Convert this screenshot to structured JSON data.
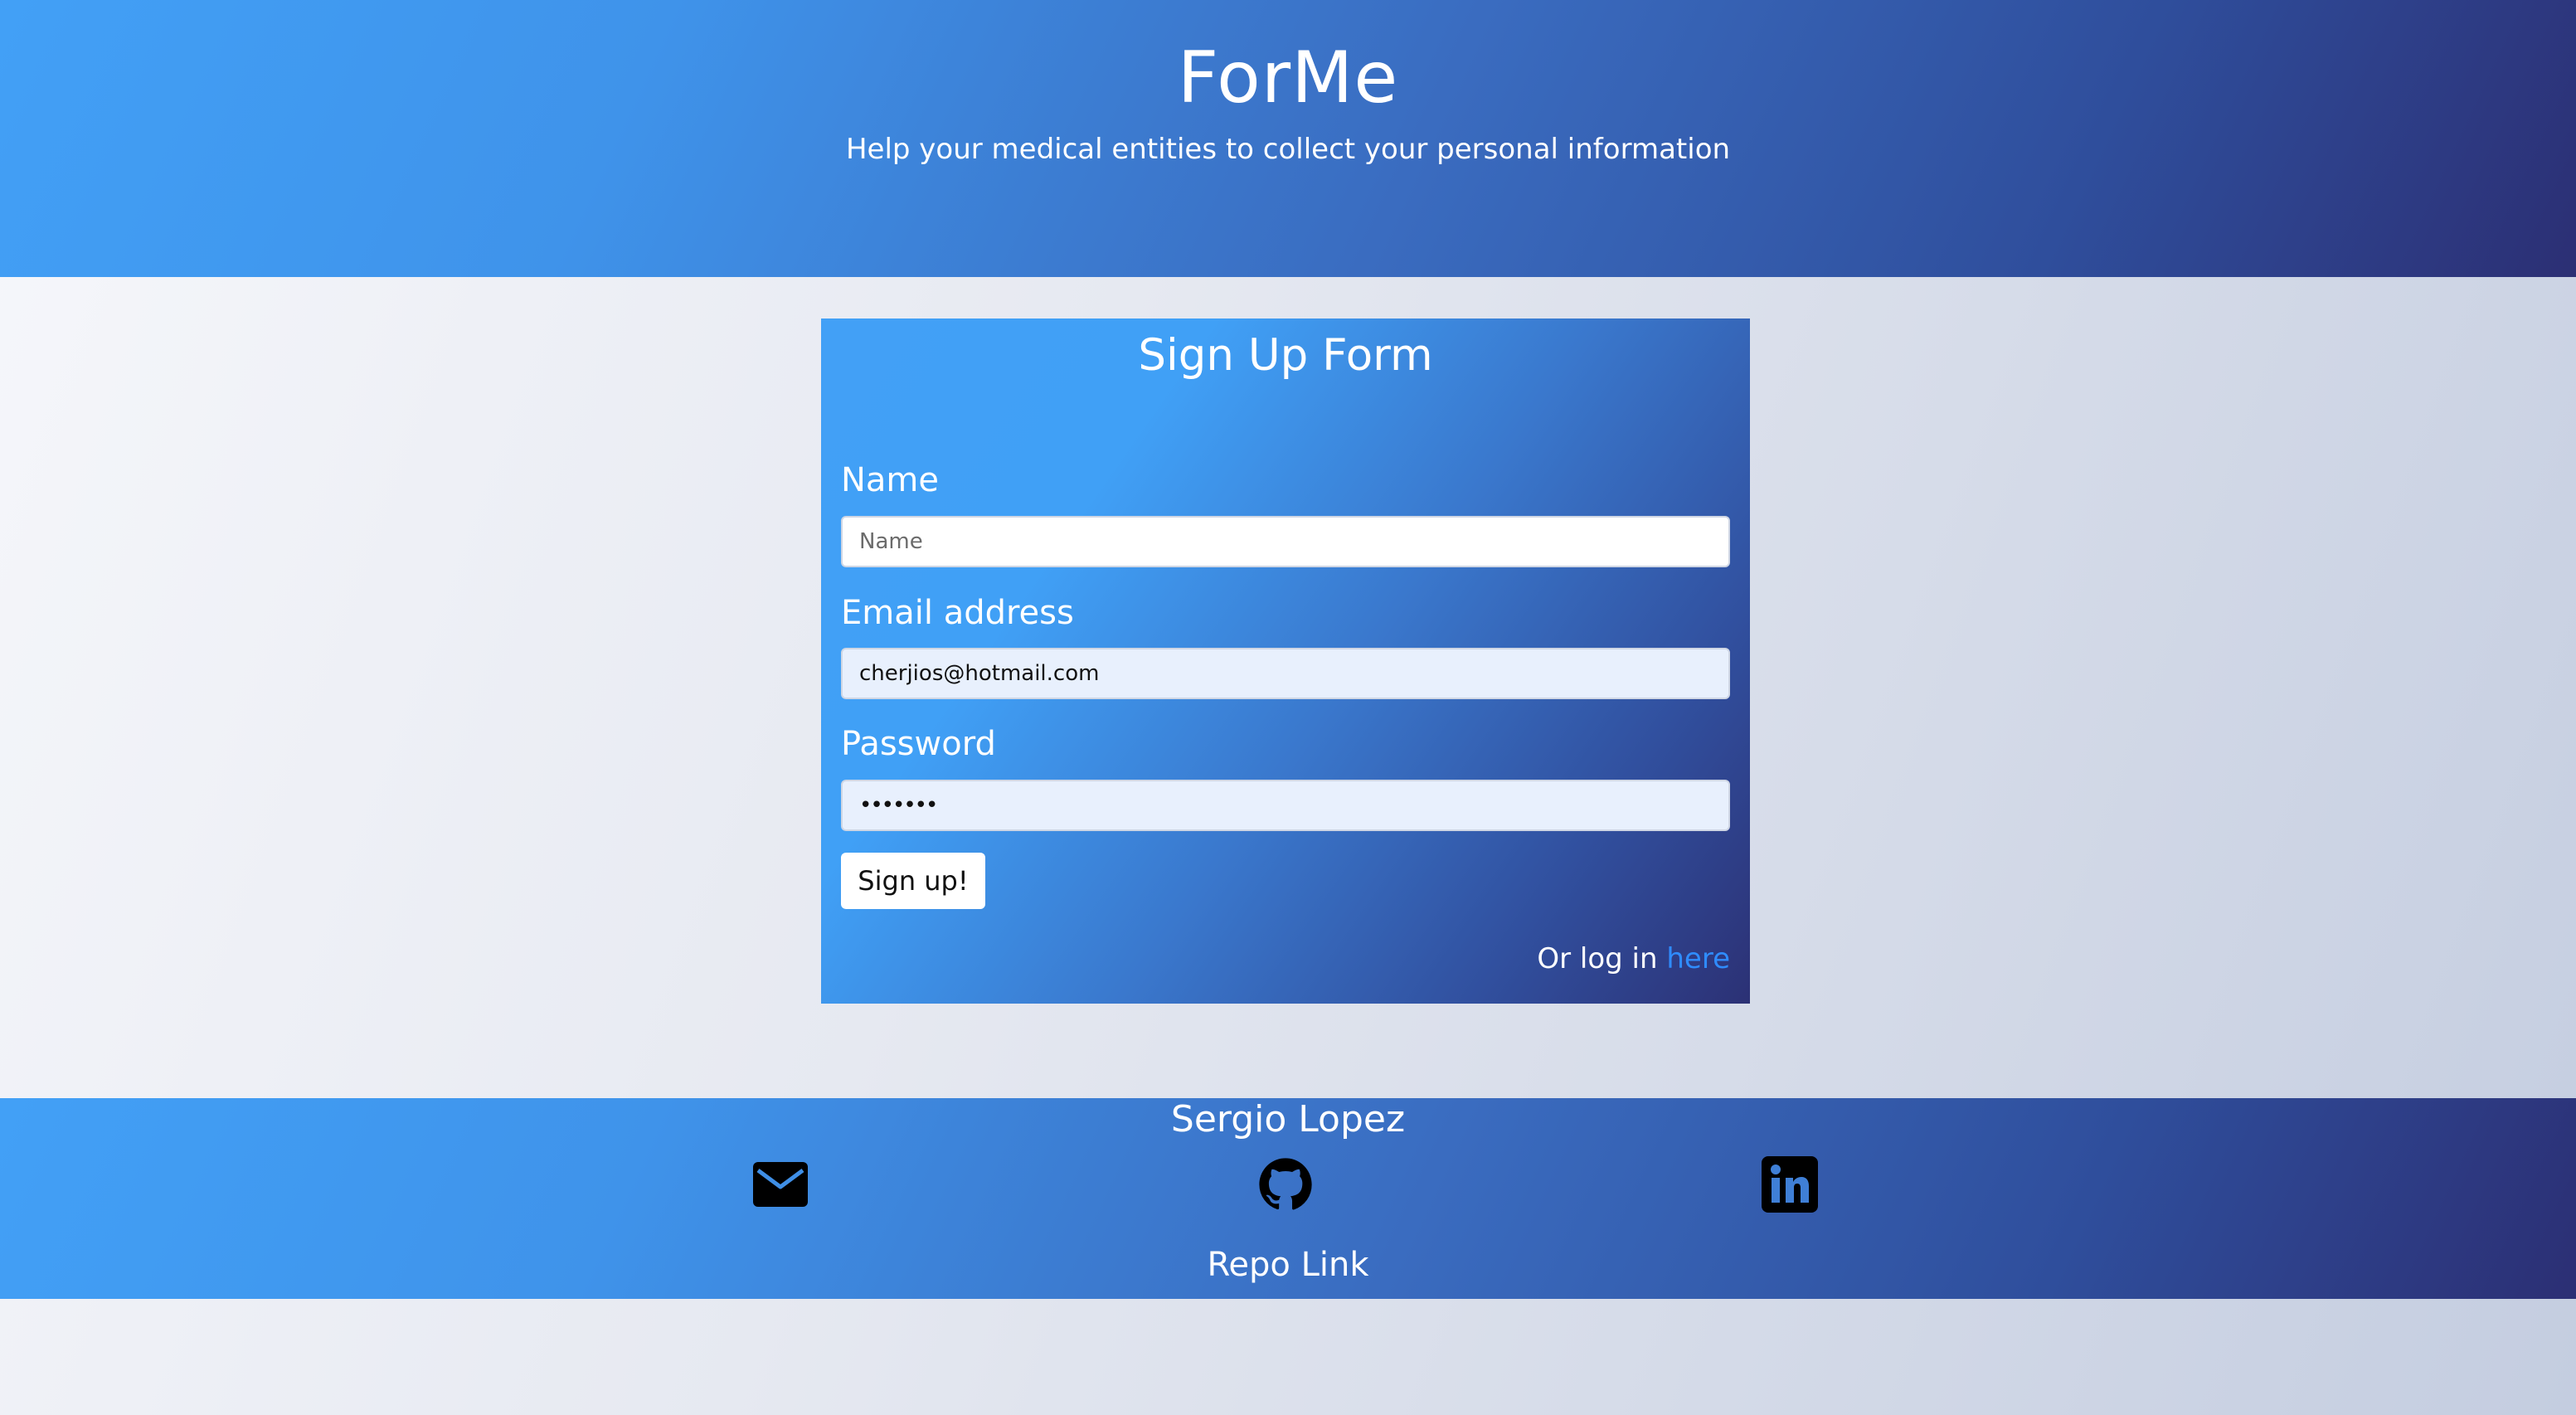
{
  "header": {
    "brand": "ForMe",
    "tagline": "Help your medical entities to collect your personal information"
  },
  "form": {
    "title": "Sign Up Form",
    "name_label": "Name",
    "name_placeholder": "Name",
    "email_label": "Email address",
    "email_value": "cherjios@hotmail.com",
    "password_label": "Password",
    "password_value": "•••••••",
    "submit_label": "Sign up!",
    "login_prefix": "Or log in",
    "login_link": "here"
  },
  "footer": {
    "author": "Sergio Lopez",
    "social": [
      {
        "icon": "mail-icon"
      },
      {
        "icon": "github-icon"
      },
      {
        "icon": "linkedin-icon"
      }
    ],
    "repo_link": "Repo Link"
  },
  "colors": {
    "gradient_start": "#42a0f6",
    "gradient_end": "#2c2f74",
    "link": "#2f8cff"
  }
}
